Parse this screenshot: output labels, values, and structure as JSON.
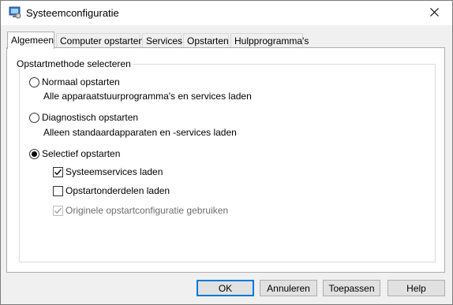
{
  "window": {
    "title": "Systeemconfiguratie"
  },
  "tabs": [
    {
      "label": "Algemeen",
      "active": true
    },
    {
      "label": "Computer opstarten",
      "active": false
    },
    {
      "label": "Services",
      "active": false
    },
    {
      "label": "Opstarten",
      "active": false
    },
    {
      "label": "Hulpprogramma's",
      "active": false
    }
  ],
  "general": {
    "group_label": "Opstartmethode selecteren",
    "options": [
      {
        "label": "Normaal opstarten",
        "description": "Alle apparaatstuurprogramma's en services laden",
        "selected": false
      },
      {
        "label": "Diagnostisch opstarten",
        "description": "Alleen standaardapparaten en -services laden",
        "selected": false
      },
      {
        "label": "Selectief opstarten",
        "description": "",
        "selected": true
      }
    ],
    "selective_options": [
      {
        "label": "Systeemservices laden",
        "checked": true,
        "enabled": true
      },
      {
        "label": "Opstartonderdelen laden",
        "checked": false,
        "enabled": true
      },
      {
        "label": "Originele opstartconfiguratie gebruiken",
        "checked": true,
        "enabled": false
      }
    ]
  },
  "buttons": {
    "ok": "OK",
    "cancel": "Annuleren",
    "apply": "Toepassen",
    "help": "Help"
  },
  "colors": {
    "accent": "#0078d7",
    "panel": "#ffffff",
    "dialog": "#f0f0f0"
  },
  "icons": {
    "app": "msconfig-icon",
    "close": "close-icon",
    "check": "checkmark-icon"
  }
}
